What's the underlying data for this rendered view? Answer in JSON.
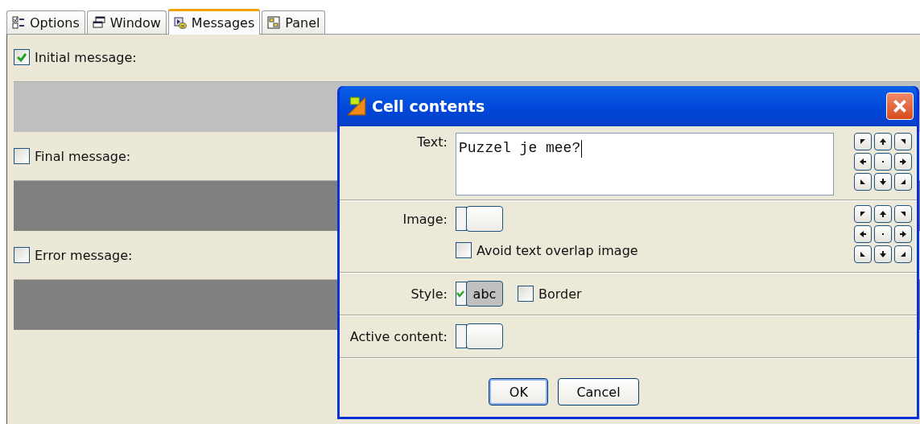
{
  "tabs": [
    {
      "label": "Options",
      "kind": "options",
      "selected": false
    },
    {
      "label": "Window",
      "kind": "window",
      "selected": false
    },
    {
      "label": "Messages",
      "kind": "messages",
      "selected": true
    },
    {
      "label": "Panel",
      "kind": "panel",
      "selected": false
    }
  ],
  "messages": [
    {
      "label": "Initial message:",
      "checked": true
    },
    {
      "label": "Final message:",
      "checked": false
    },
    {
      "label": "Error message:",
      "checked": false
    }
  ],
  "dialog": {
    "title": "Cell contents",
    "rows": [
      {
        "kind": "text",
        "label": "Text:",
        "value": "Puzzel je mee?"
      },
      {
        "kind": "image",
        "label": "Image:",
        "option": {
          "label": "Avoid text overlap image",
          "checked": false
        }
      },
      {
        "kind": "style",
        "label": "Style:",
        "style_button": {
          "label": "abc",
          "checked": true
        },
        "border": {
          "label": "Border",
          "checked": false
        }
      },
      {
        "kind": "active",
        "label": "Active content:"
      }
    ],
    "buttons": [
      {
        "label": "OK",
        "default": true
      },
      {
        "label": "Cancel",
        "default": false
      }
    ]
  }
}
